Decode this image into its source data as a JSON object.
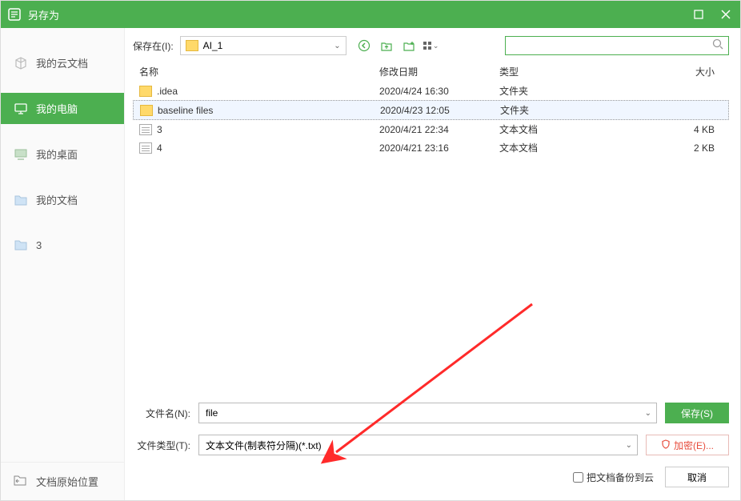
{
  "window": {
    "title": "另存为"
  },
  "sidebar": {
    "items": [
      {
        "label": "我的云文档",
        "icon": "cube-icon"
      },
      {
        "label": "我的电脑",
        "icon": "monitor-icon"
      },
      {
        "label": "我的桌面",
        "icon": "desktop-icon"
      },
      {
        "label": "我的文档",
        "icon": "folder-icon"
      },
      {
        "label": "3",
        "icon": "folder-icon"
      }
    ],
    "footer": {
      "label": "文档原始位置"
    }
  },
  "toolbar": {
    "save_in_label": "保存在(I):",
    "current_folder": "AI_1"
  },
  "columns": {
    "name": "名称",
    "date": "修改日期",
    "type": "类型",
    "size": "大小"
  },
  "files": [
    {
      "name": ".idea",
      "date": "2020/4/24 16:30",
      "type": "文件夹",
      "size": "",
      "kind": "folder"
    },
    {
      "name": "baseline files",
      "date": "2020/4/23 12:05",
      "type": "文件夹",
      "size": "",
      "kind": "folder",
      "selected": true
    },
    {
      "name": "3",
      "date": "2020/4/21 22:34",
      "type": "文本文档",
      "size": "4 KB",
      "kind": "file"
    },
    {
      "name": "4",
      "date": "2020/4/21 23:16",
      "type": "文本文档",
      "size": "2 KB",
      "kind": "file"
    }
  ],
  "form": {
    "filename_label": "文件名(N):",
    "filename_value": "file",
    "filetype_label": "文件类型(T):",
    "filetype_value": "文本文件(制表符分隔)(*.txt)",
    "save_btn": "保存(S)",
    "encrypt_btn": "加密(E)...",
    "backup_label": "把文档备份到云",
    "cancel_btn": "取消"
  }
}
